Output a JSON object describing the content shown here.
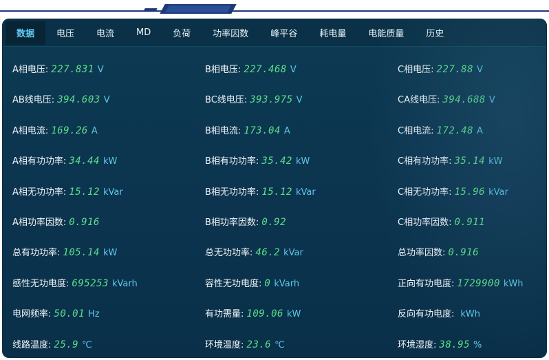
{
  "tabs": [
    {
      "label": "数据",
      "active": true
    },
    {
      "label": "电压"
    },
    {
      "label": "电流"
    },
    {
      "label": "MD"
    },
    {
      "label": "负荷"
    },
    {
      "label": "功率因数"
    },
    {
      "label": "峰平谷"
    },
    {
      "label": "耗电量"
    },
    {
      "label": "电能质量"
    },
    {
      "label": "历史"
    }
  ],
  "readings": [
    [
      {
        "label": "A相电压:",
        "value": "227.831",
        "unit": "V"
      },
      {
        "label": "B相电压:",
        "value": "227.468",
        "unit": "V"
      },
      {
        "label": "C相电压:",
        "value": "227.88",
        "unit": "V"
      }
    ],
    [
      {
        "label": "AB线电压:",
        "value": "394.603",
        "unit": "V"
      },
      {
        "label": "BC线电压:",
        "value": "393.975",
        "unit": "V"
      },
      {
        "label": "CA线电压:",
        "value": "394.688",
        "unit": "V"
      }
    ],
    [
      {
        "label": "A相电流:",
        "value": "169.26",
        "unit": "A"
      },
      {
        "label": "B相电流:",
        "value": "173.04",
        "unit": "A"
      },
      {
        "label": "C相电流:",
        "value": "172.48",
        "unit": "A"
      }
    ],
    [
      {
        "label": "A相有功功率:",
        "value": "34.44",
        "unit": "kW"
      },
      {
        "label": "B相有功功率:",
        "value": "35.42",
        "unit": "kW"
      },
      {
        "label": "C相有功功率:",
        "value": "35.14",
        "unit": "kW"
      }
    ],
    [
      {
        "label": "A相无功功率:",
        "value": "15.12",
        "unit": "kVar"
      },
      {
        "label": "B相无功功率:",
        "value": "15.12",
        "unit": "kVar"
      },
      {
        "label": "C相无功功率:",
        "value": "15.96",
        "unit": "kVar"
      }
    ],
    [
      {
        "label": "A相功率因数:",
        "value": "0.916",
        "unit": ""
      },
      {
        "label": "B相功率因数:",
        "value": "0.92",
        "unit": ""
      },
      {
        "label": "C相功率因数:",
        "value": "0.911",
        "unit": ""
      }
    ],
    [
      {
        "label": "总有功功率:",
        "value": "105.14",
        "unit": "kW"
      },
      {
        "label": "总无功功率:",
        "value": "46.2",
        "unit": "kVar"
      },
      {
        "label": "总功率因数:",
        "value": "0.916",
        "unit": ""
      }
    ],
    [
      {
        "label": "感性无功电度:",
        "value": "695253",
        "unit": "kVarh"
      },
      {
        "label": "容性无功电度:",
        "value": "0",
        "unit": "kVarh"
      },
      {
        "label": "正向有功电度:",
        "value": "1729900",
        "unit": "kWh"
      }
    ],
    [
      {
        "label": "电网频率:",
        "value": "50.01",
        "unit": "Hz"
      },
      {
        "label": "有功需量:",
        "value": "109.06",
        "unit": "kW"
      },
      {
        "label": "反向有功电度:",
        "value": "",
        "unit": "kWh"
      }
    ],
    [
      {
        "label": "线路温度:",
        "value": "25.9",
        "unit": "℃"
      },
      {
        "label": "环境温度:",
        "value": "23.6",
        "unit": "℃"
      },
      {
        "label": "环境湿度:",
        "value": "38.95",
        "unit": "%"
      }
    ]
  ],
  "colors": {
    "panel_bg": "#0c3550",
    "active_tab": "#5ec8f0",
    "value": "#5be08a",
    "unit": "#5dc7e8",
    "label": "#f2f6f8"
  }
}
